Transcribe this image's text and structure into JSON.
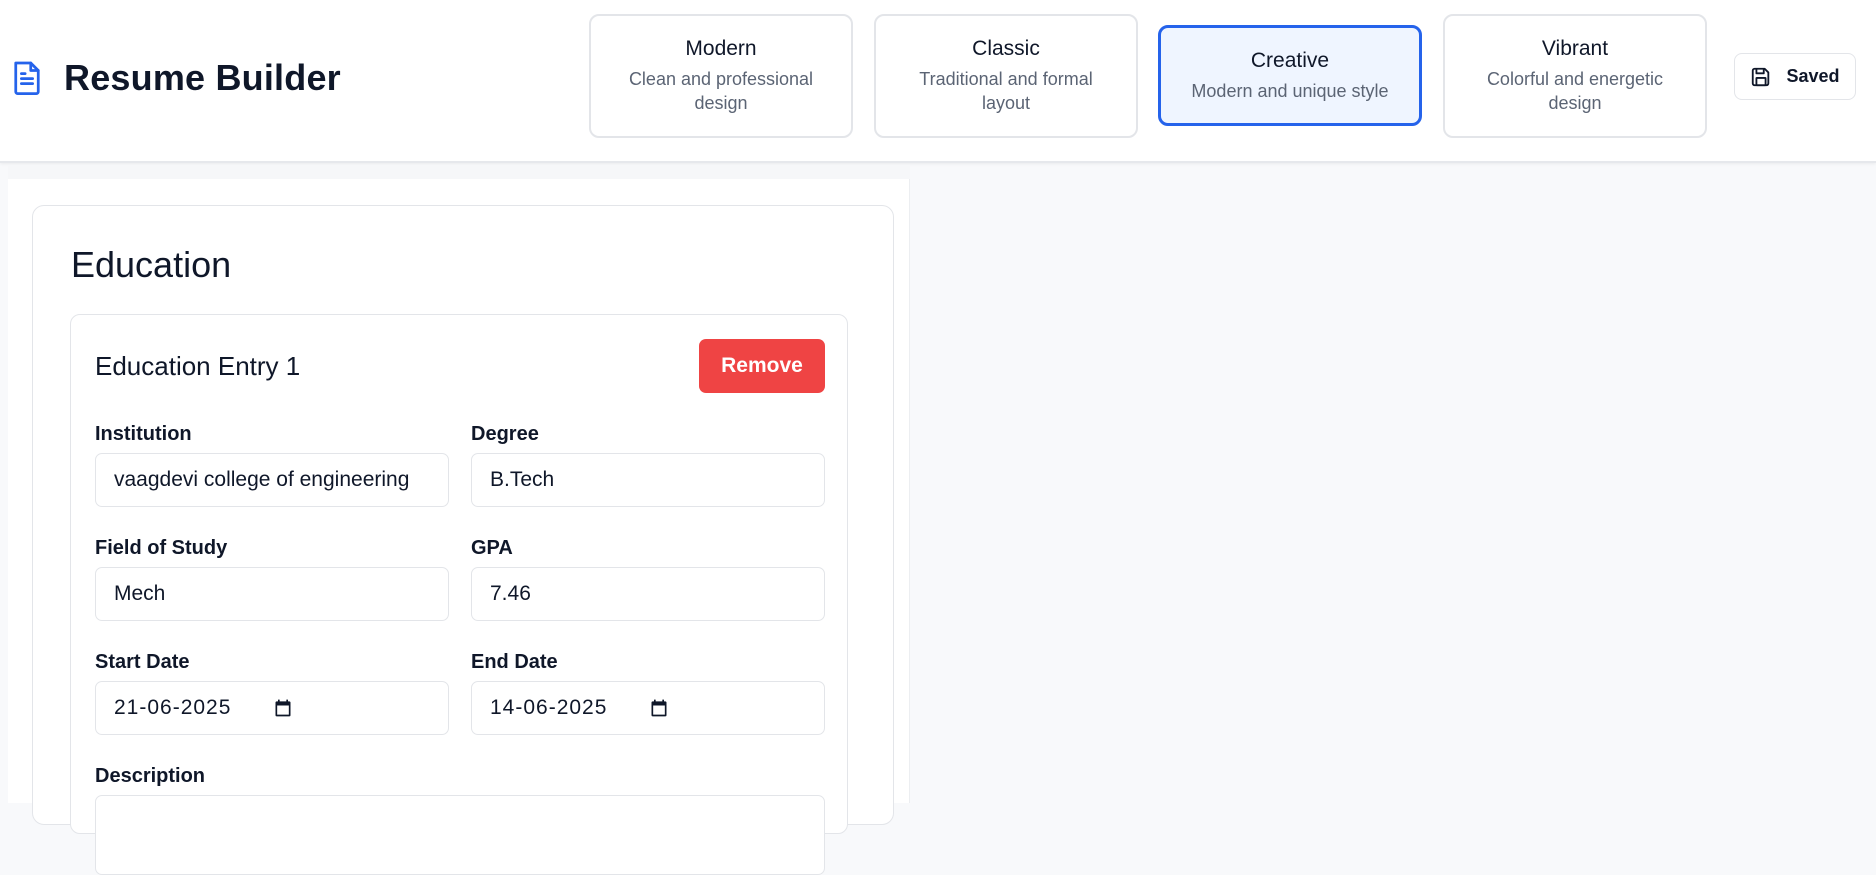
{
  "app": {
    "title": "Resume Builder"
  },
  "templates": [
    {
      "name": "Modern",
      "description": "Clean and professional design",
      "selected": false
    },
    {
      "name": "Classic",
      "description": "Traditional and formal layout",
      "selected": false
    },
    {
      "name": "Creative",
      "description": "Modern and unique style",
      "selected": true
    },
    {
      "name": "Vibrant",
      "description": "Colorful and energetic design",
      "selected": false
    }
  ],
  "save_status": {
    "label": "Saved",
    "icon": "save-icon"
  },
  "education": {
    "title": "Education",
    "entry": {
      "title": "Education Entry 1",
      "remove_label": "Remove",
      "institution": {
        "label": "Institution",
        "value": "vaagdevi college of engineering"
      },
      "degree": {
        "label": "Degree",
        "value": "B.Tech"
      },
      "field_of_study": {
        "label": "Field of Study",
        "value": "Mech"
      },
      "gpa": {
        "label": "GPA",
        "value": "7.46"
      },
      "start_date": {
        "label": "Start Date",
        "value": "21-06-2025"
      },
      "end_date": {
        "label": "End Date",
        "value": "14-06-2025"
      },
      "description": {
        "label": "Description"
      }
    }
  },
  "colors": {
    "accent": "#2563eb",
    "danger": "#ef4444",
    "selected_bg": "#eff5ff",
    "page_bg": "#f8f9fb"
  }
}
